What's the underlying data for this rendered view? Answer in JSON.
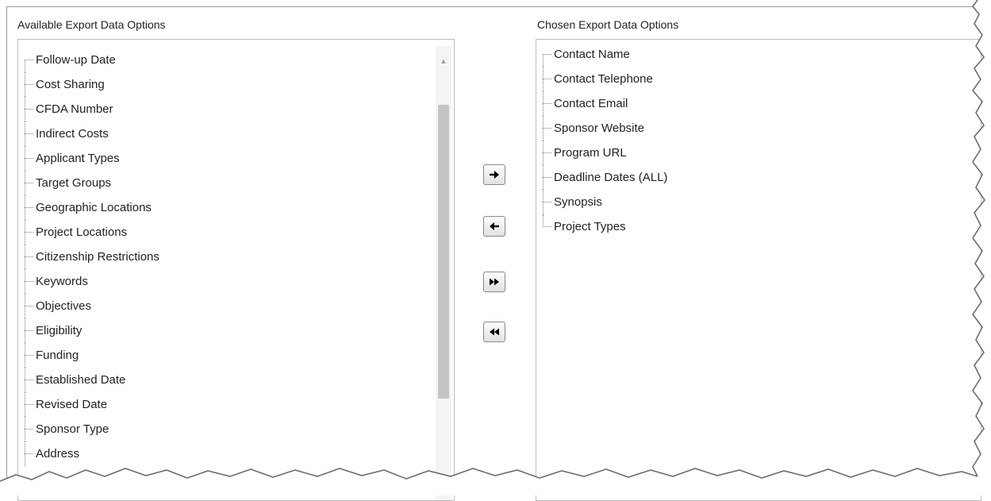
{
  "available": {
    "label": "Available Export Data Options",
    "items": [
      "Follow-up Date",
      "Cost Sharing",
      "CFDA Number",
      "Indirect Costs",
      "Applicant Types",
      "Target Groups",
      "Geographic Locations",
      "Project Locations",
      "Citizenship Restrictions",
      "Keywords",
      "Objectives",
      "Eligibility",
      "Funding",
      "Established Date",
      "Revised Date",
      "Sponsor Type",
      "Address"
    ]
  },
  "chosen": {
    "label": "Chosen Export Data Options",
    "items": [
      "Contact Name",
      "Contact Telephone",
      "Contact Email",
      "Sponsor Website",
      "Program URL",
      "Deadline Dates (ALL)",
      "Synopsis",
      "Project Types"
    ]
  },
  "buttons": {
    "add": "arrow-right-icon",
    "remove": "arrow-left-icon",
    "add_all": "double-arrow-right-icon",
    "remove_all": "double-arrow-left-icon"
  },
  "colors": {
    "border": "#bdbdbd",
    "scroll_thumb": "#c4c4c4",
    "tree_line": "#7d7d7d"
  }
}
